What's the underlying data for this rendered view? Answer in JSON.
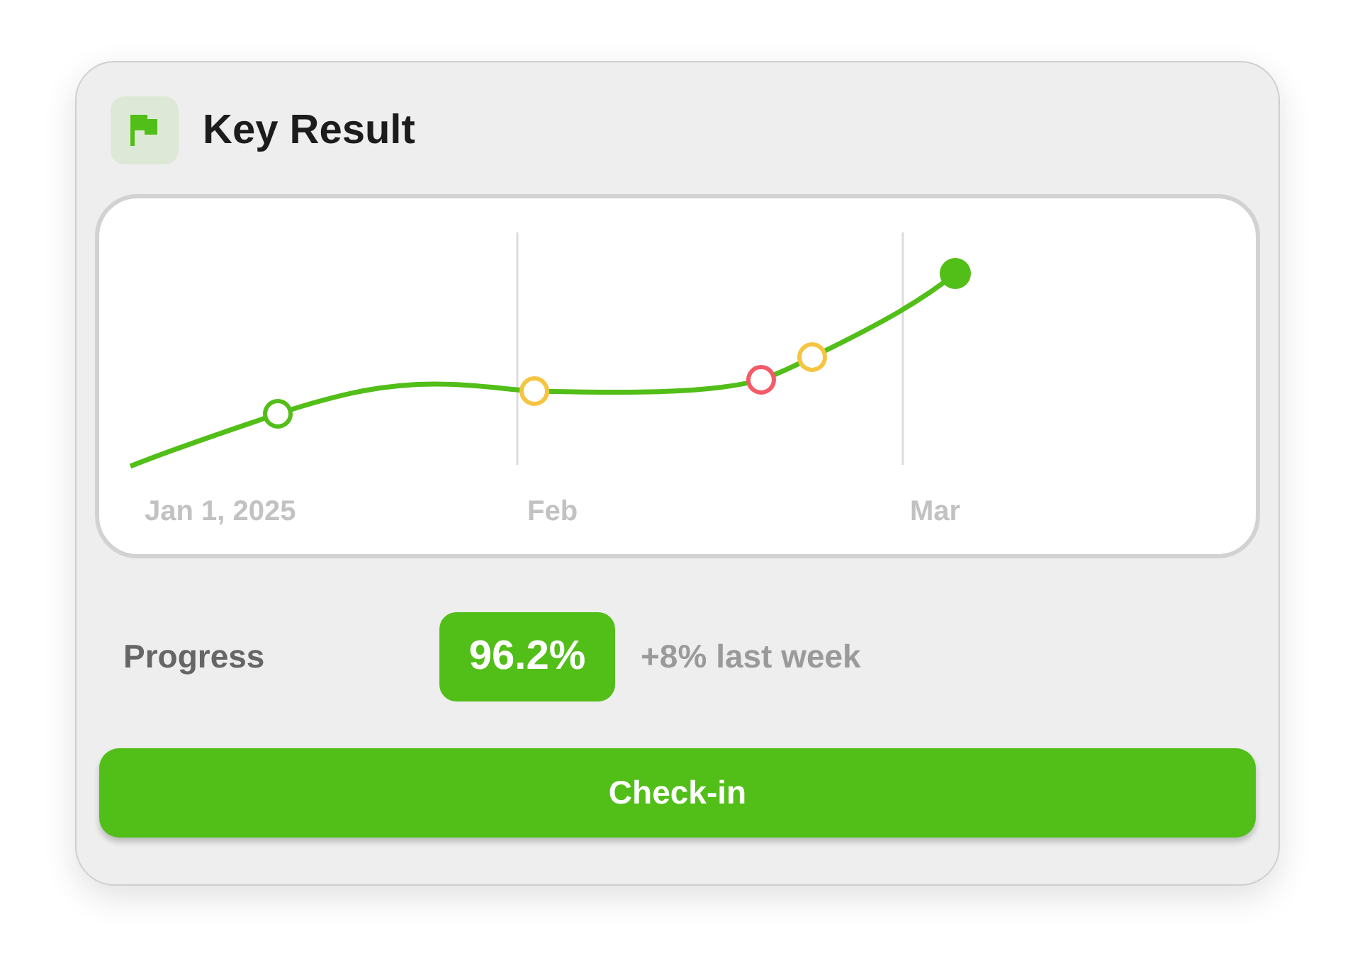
{
  "card": {
    "title": "Key Result"
  },
  "chart": {
    "x_labels": [
      "Jan 1, 2025",
      "Feb",
      "Mar"
    ],
    "check_ins": [
      {
        "color": "#52be18",
        "filled": false
      },
      {
        "color": "#f5c542",
        "filled": false
      },
      {
        "color": "#f45b69",
        "filled": false
      },
      {
        "color": "#f5c542",
        "filled": false
      },
      {
        "color": "#52be18",
        "filled": true
      }
    ]
  },
  "progress": {
    "label": "Progress",
    "value": "96.2%",
    "change": "+8% last week"
  },
  "button": {
    "label": "Check-in"
  }
}
